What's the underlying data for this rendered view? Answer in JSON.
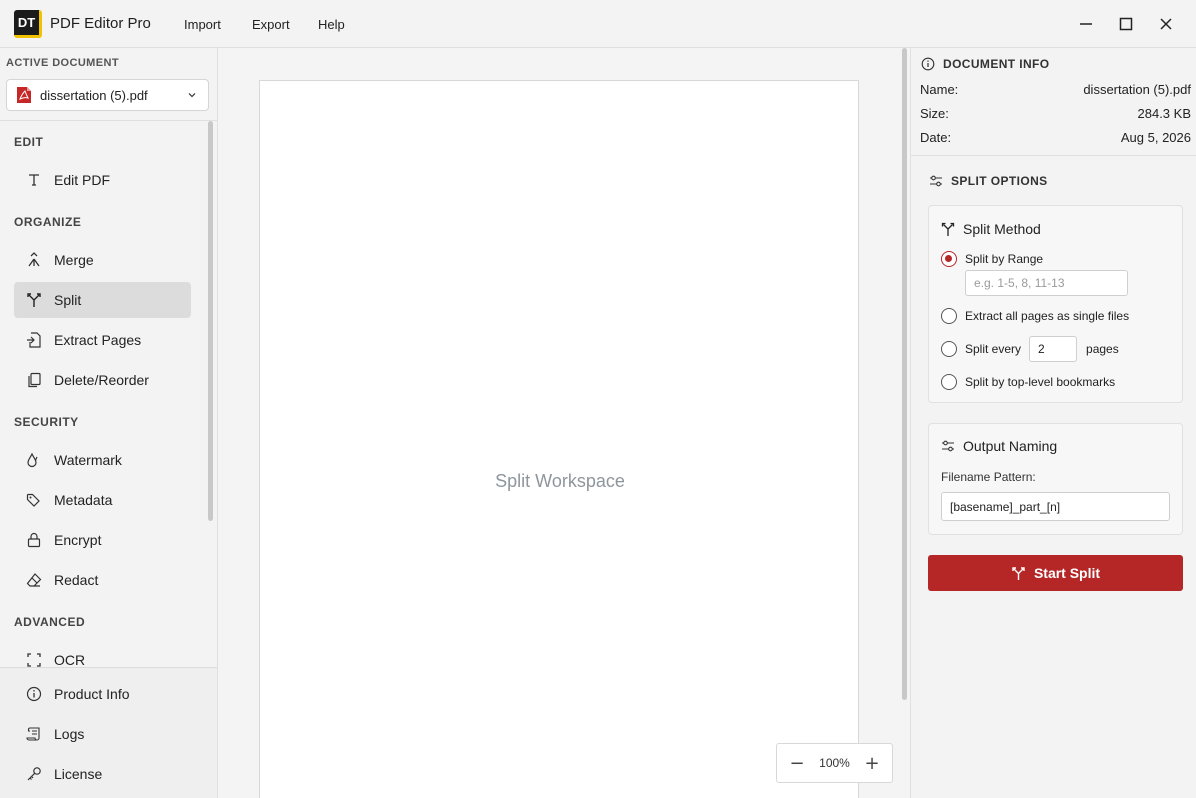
{
  "app": {
    "logo_text": "DT",
    "title": "PDF Editor Pro",
    "menu": [
      "Import",
      "Export",
      "Help"
    ]
  },
  "sidebar": {
    "active_document_label": "ACTIVE DOCUMENT",
    "active_document": "dissertation (5).pdf",
    "sections": [
      {
        "label": "EDIT",
        "items": [
          {
            "label": "Edit PDF",
            "icon": "text-icon"
          }
        ]
      },
      {
        "label": "ORGANIZE",
        "items": [
          {
            "label": "Merge",
            "icon": "merge-icon"
          },
          {
            "label": "Split",
            "icon": "split-icon",
            "selected": true
          },
          {
            "label": "Extract Pages",
            "icon": "extract-icon"
          },
          {
            "label": "Delete/Reorder",
            "icon": "copy-icon"
          }
        ]
      },
      {
        "label": "SECURITY",
        "items": [
          {
            "label": "Watermark",
            "icon": "droplet-icon"
          },
          {
            "label": "Metadata",
            "icon": "tag-icon"
          },
          {
            "label": "Encrypt",
            "icon": "lock-icon"
          },
          {
            "label": "Redact",
            "icon": "eraser-icon"
          }
        ]
      },
      {
        "label": "ADVANCED",
        "items": [
          {
            "label": "OCR",
            "icon": "scan-icon"
          }
        ]
      }
    ],
    "bottom_items": [
      {
        "label": "Product Info",
        "icon": "info-icon"
      },
      {
        "label": "Logs",
        "icon": "scroll-icon"
      },
      {
        "label": "License",
        "icon": "key-icon"
      }
    ]
  },
  "workspace": {
    "label": "Split Workspace",
    "zoom": "100%"
  },
  "document_info": {
    "heading": "DOCUMENT INFO",
    "rows": [
      {
        "key": "Name:",
        "value": "dissertation (5).pdf"
      },
      {
        "key": "Size:",
        "value": "284.3 KB"
      },
      {
        "key": "Date:",
        "value": "Aug 5, 2026"
      }
    ]
  },
  "split_options": {
    "heading": "SPLIT OPTIONS",
    "method": {
      "title": "Split Method",
      "by_range": "Split by Range",
      "range_placeholder": "e.g. 1-5, 8, 11-13",
      "extract_all": "Extract all pages as single files",
      "split_every": "Split every",
      "every_value": "2",
      "pages_suffix": "pages",
      "by_bookmarks": "Split by top-level bookmarks"
    },
    "naming": {
      "title": "Output Naming",
      "pattern_label": "Filename Pattern:",
      "pattern_value": "[basename]_part_[n]"
    },
    "start_label": "Start Split"
  },
  "colors": {
    "accent": "#b52626",
    "selected_nav": "#dcdcdc",
    "logo_accent": "#f2c200"
  }
}
